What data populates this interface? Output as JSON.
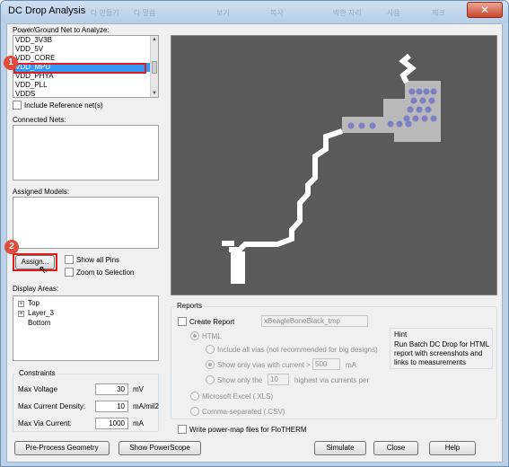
{
  "window": {
    "title": "DC Drop Analysis",
    "close_glyph": "✕",
    "ghost_menu": [
      "다 만들기",
      "다 말씀",
      "보기",
      "복사",
      "박한 자리",
      "사용",
      "제크"
    ]
  },
  "net_section": {
    "label": "Power/Ground Net to Analyze:",
    "items": [
      "VDD_3V3B",
      "VDD_5V",
      "VDD_CORE",
      "VDD_MPU",
      "VDD_PHYA",
      "VDD_PLL",
      "VDDS"
    ],
    "selected_index": 3,
    "include_reference_label": "Include Reference net(s)"
  },
  "connected_nets": {
    "label": "Connected Nets:"
  },
  "assigned_models": {
    "label": "Assigned Models:"
  },
  "assign": {
    "button_label": "Assign...",
    "show_all_pins_label": "Show all Pins",
    "zoom_to_selection_label": "Zoom to Selection"
  },
  "badges": {
    "one": "1",
    "two": "2"
  },
  "display_areas": {
    "label": "Display Areas:",
    "items": [
      {
        "label": "Top",
        "expander": "+"
      },
      {
        "label": "Layer_3",
        "expander": "+"
      },
      {
        "label": "Bottom",
        "expander": ""
      }
    ]
  },
  "constraints": {
    "title": "Constraints",
    "rows": [
      {
        "label": "Max Voltage",
        "value": "30",
        "unit": "mV"
      },
      {
        "label": "Max Current Density:",
        "value": "10",
        "unit": "mA/mil2"
      },
      {
        "label": "Max Via Current:",
        "value": "1000",
        "unit": "mA"
      }
    ]
  },
  "reports": {
    "title": "Reports",
    "create_report_label": "Create Report",
    "report_name": "xBeagleBoneBlack_tmp",
    "html_label": "HTML",
    "include_all_vias_label": "Include all vias (not recommended for big designs)",
    "show_vias_current_label": "Show only vias with current >",
    "show_vias_current_value": "500",
    "show_vias_current_unit": "mA",
    "show_only_label": "Show only the",
    "show_only_value": "10",
    "show_only_suffix": "highest via currents per",
    "excel_label": "Microsoft Excel (.XLS)",
    "csv_label": "Comma-separated (.CSV)",
    "hint_title": "Hint",
    "hint_text": [
      "Run Batch DC Drop for HTML",
      "report with screenshots and",
      "links to measurements"
    ]
  },
  "flotherm_label": "Write power-map files for FloTHERM",
  "buttons": {
    "preprocess": "Pre-Process Geometry",
    "show_powerscope": "Show PowerScope",
    "simulate": "Simulate",
    "close": "Close",
    "help": "Help"
  },
  "canvas": {
    "background": "#5a5a5a",
    "trace_color": "#ffffff",
    "plane_color": "#b9b9b9",
    "via_color": "#7d7fc4"
  }
}
